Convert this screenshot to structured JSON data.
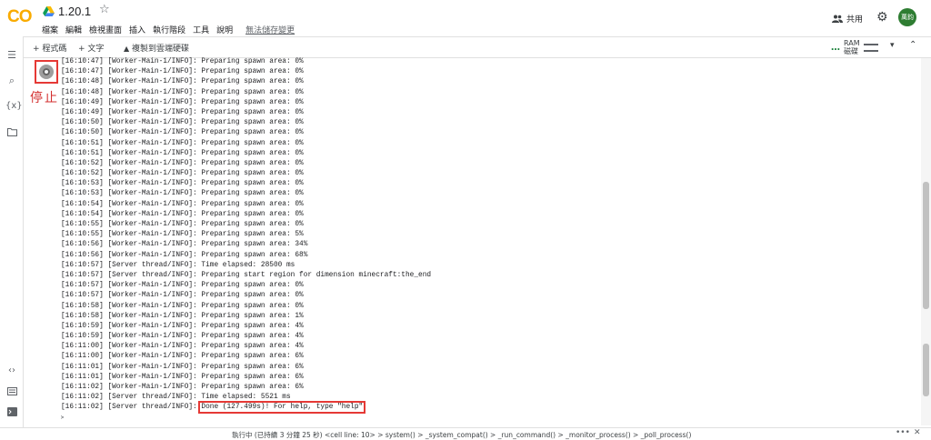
{
  "header": {
    "logo": "CO",
    "notebook_title": "1.20.1",
    "menu": [
      "檔案",
      "編輯",
      "檢視畫面",
      "插入",
      "執行階段",
      "工具",
      "說明"
    ],
    "unsaved": "無法儲存變更",
    "share_label": "共用",
    "avatar_text": "萬鈞"
  },
  "toolbar": {
    "add_code": "+ 程式碼",
    "add_text": "+ 文字",
    "copy_to_drive": "複製到雲端硬碟",
    "ram_label": "RAM",
    "disk_label": "磁碟"
  },
  "cell": {
    "stop_label": "停止",
    "log": [
      "[16:10:47] [Worker-Main-1/INFO]: Preparing spawn area: 0%",
      "[16:10:47] [Worker-Main-1/INFO]: Preparing spawn area: 0%",
      "[16:10:48] [Worker-Main-1/INFO]: Preparing spawn area: 0%",
      "[16:10:48] [Worker-Main-1/INFO]: Preparing spawn area: 0%",
      "[16:10:49] [Worker-Main-1/INFO]: Preparing spawn area: 0%",
      "[16:10:49] [Worker-Main-1/INFO]: Preparing spawn area: 0%",
      "[16:10:50] [Worker-Main-1/INFO]: Preparing spawn area: 0%",
      "[16:10:50] [Worker-Main-1/INFO]: Preparing spawn area: 0%",
      "[16:10:51] [Worker-Main-1/INFO]: Preparing spawn area: 0%",
      "[16:10:51] [Worker-Main-1/INFO]: Preparing spawn area: 0%",
      "[16:10:52] [Worker-Main-1/INFO]: Preparing spawn area: 0%",
      "[16:10:52] [Worker-Main-1/INFO]: Preparing spawn area: 0%",
      "[16:10:53] [Worker-Main-1/INFO]: Preparing spawn area: 0%",
      "[16:10:53] [Worker-Main-1/INFO]: Preparing spawn area: 0%",
      "[16:10:54] [Worker-Main-1/INFO]: Preparing spawn area: 0%",
      "[16:10:54] [Worker-Main-1/INFO]: Preparing spawn area: 0%",
      "[16:10:55] [Worker-Main-1/INFO]: Preparing spawn area: 0%",
      "[16:10:55] [Worker-Main-1/INFO]: Preparing spawn area: 5%",
      "[16:10:56] [Worker-Main-1/INFO]: Preparing spawn area: 34%",
      "[16:10:56] [Worker-Main-1/INFO]: Preparing spawn area: 68%",
      "[16:10:57] [Server thread/INFO]: Time elapsed: 28500 ms",
      "[16:10:57] [Server thread/INFO]: Preparing start region for dimension minecraft:the_end",
      "[16:10:57] [Worker-Main-1/INFO]: Preparing spawn area: 0%",
      "[16:10:57] [Worker-Main-1/INFO]: Preparing spawn area: 0%",
      "[16:10:58] [Worker-Main-1/INFO]: Preparing spawn area: 0%",
      "[16:10:58] [Worker-Main-1/INFO]: Preparing spawn area: 1%",
      "[16:10:59] [Worker-Main-1/INFO]: Preparing spawn area: 4%",
      "[16:10:59] [Worker-Main-1/INFO]: Preparing spawn area: 4%",
      "[16:11:00] [Worker-Main-1/INFO]: Preparing spawn area: 4%",
      "[16:11:00] [Worker-Main-1/INFO]: Preparing spawn area: 6%",
      "[16:11:01] [Worker-Main-1/INFO]: Preparing spawn area: 6%",
      "[16:11:01] [Worker-Main-1/INFO]: Preparing spawn area: 6%",
      "[16:11:02] [Worker-Main-1/INFO]: Preparing spawn area: 6%",
      "[16:11:02] [Server thread/INFO]: Time elapsed: 5521 ms"
    ],
    "done_prefix": "[16:11:02] [Server thread/INFO]: ",
    "done_message": "Done (127.499s)! For help, type \"help\"",
    "prompt": ">"
  },
  "statusbar": {
    "text": "執行中 (已持續 3 分鐘 25 秒)  <cell line: 10> > system() > _system_compat() > _run_command() > _monitor_process() > _poll_process()",
    "more": "•••",
    "close": "✕"
  },
  "colors": {
    "accent": "#f9ab00",
    "highlight_box": "#e53935",
    "avatar_bg": "#2e7d32"
  }
}
